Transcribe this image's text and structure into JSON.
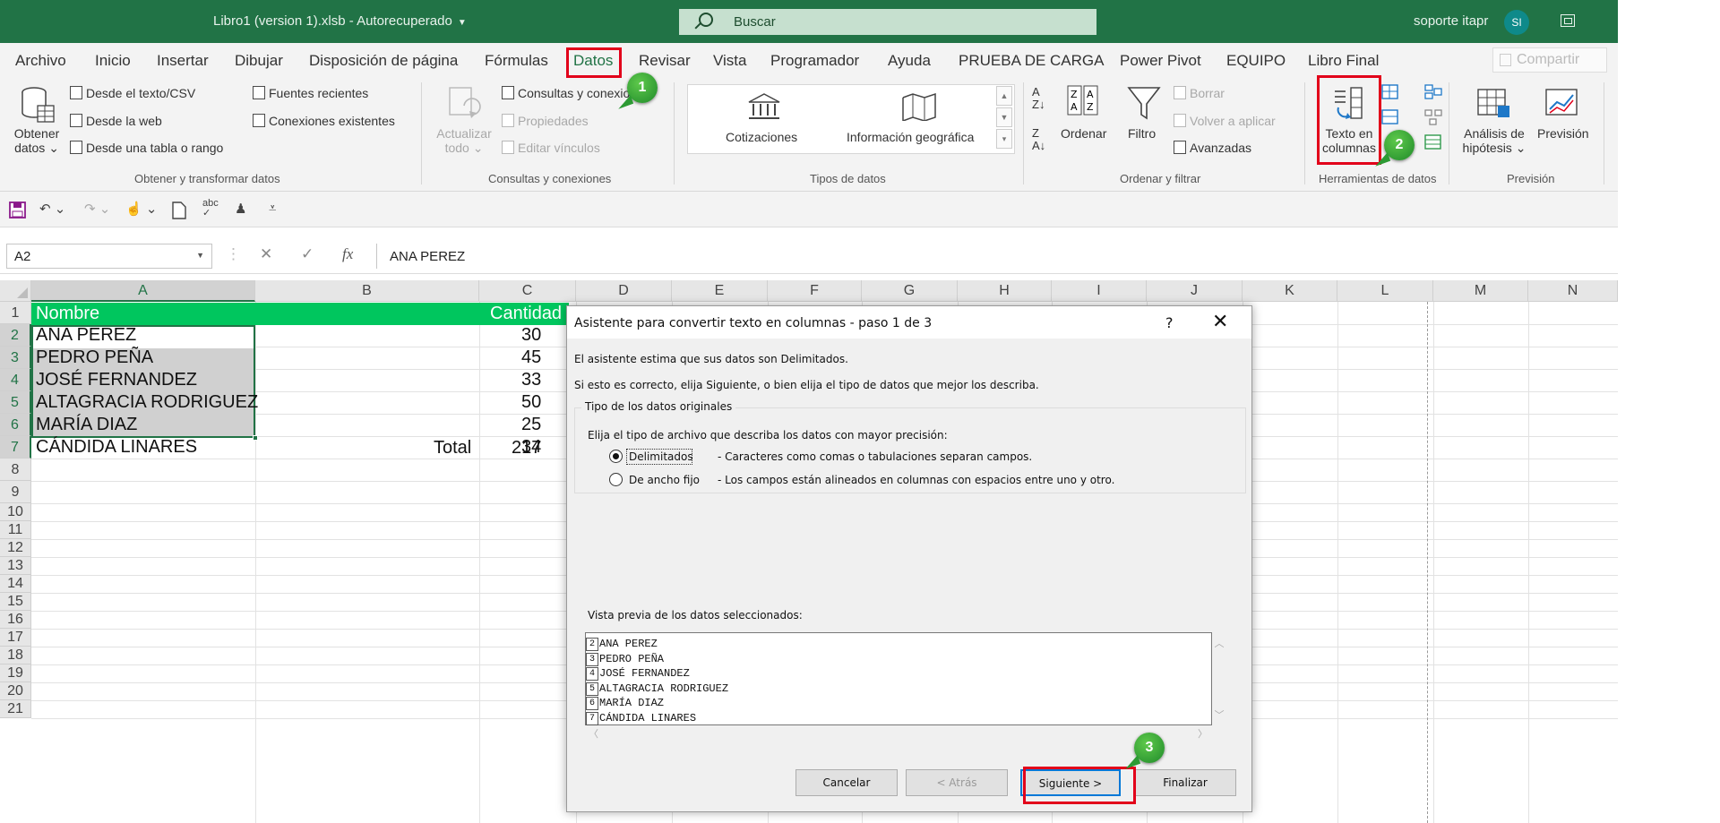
{
  "window": {
    "title": "Libro1 (version 1).xlsb  -  Autorecuperado",
    "search_placeholder": "Buscar",
    "user": "soporte itapr",
    "avatar": "SI"
  },
  "tabs": [
    "Archivo",
    "Inicio",
    "Insertar",
    "Dibujar",
    "Disposición de página",
    "Fórmulas",
    "Datos",
    "Revisar",
    "Vista",
    "Programador",
    "Ayuda",
    "PRUEBA DE CARGA",
    "Power Pivot",
    "EQUIPO",
    "Libro Final"
  ],
  "share": "Compartir",
  "ribbon": {
    "obtener": {
      "btn_line1": "Obtener",
      "btn_line2": "datos",
      "items": [
        "Desde el texto/CSV",
        "Desde la web",
        "Desde una tabla o rango",
        "Fuentes recientes",
        "Conexiones existentes"
      ],
      "label": "Obtener y transformar datos"
    },
    "consultas": {
      "refresh_line1": "Actualizar",
      "refresh_line2": "todo",
      "items": [
        "Consultas y conexiones",
        "Propiedades",
        "Editar vínculos"
      ],
      "label": "Consultas y conexiones"
    },
    "tipos": {
      "items": [
        "Cotizaciones",
        "Información geográfica"
      ],
      "label": "Tipos de datos"
    },
    "ordenar": {
      "sort": "Ordenar",
      "filter": "Filtro",
      "items": [
        "Borrar",
        "Volver a aplicar",
        "Avanzadas"
      ],
      "label": "Ordenar y filtrar"
    },
    "herramientas": {
      "btn_line1": "Texto en",
      "btn_line2": "columnas",
      "label": "Herramientas de datos"
    },
    "prevision": {
      "analysis_line1": "Análisis de",
      "analysis_line2": "hipótesis",
      "forecast": "Previsión",
      "label": "Previsión"
    }
  },
  "formula_bar": {
    "name_box": "A2",
    "fx": "fx",
    "value": "ANA PEREZ"
  },
  "grid": {
    "columns": [
      "A",
      "B",
      "C",
      "D",
      "E",
      "F",
      "G",
      "H",
      "I",
      "J",
      "K",
      "L",
      "M",
      "N"
    ],
    "rows": [
      "1",
      "2",
      "3",
      "4",
      "5",
      "6",
      "7",
      "8",
      "9",
      "10",
      "11",
      "12",
      "13",
      "14",
      "15",
      "16",
      "17",
      "18",
      "19",
      "20",
      "21"
    ],
    "header": {
      "name": "Nombre",
      "qty": "Cantidad"
    },
    "data": [
      {
        "name": "ANA PEREZ",
        "qty": "30"
      },
      {
        "name": "PEDRO PEÑA",
        "qty": "45"
      },
      {
        "name": "JOSÉ FERNANDEZ",
        "qty": "33"
      },
      {
        "name": "ALTAGRACIA RODRIGUEZ",
        "qty": "50"
      },
      {
        "name": "MARÍA DIAZ",
        "qty": "25"
      },
      {
        "name": "CÁNDIDA LINARES",
        "qty": "34"
      }
    ],
    "total_label": "Total",
    "total_value": "217"
  },
  "dialog": {
    "title": "Asistente para convertir texto en columnas - paso 1 de 3",
    "help": "?",
    "close": "✕",
    "line1": "El asistente estima que sus datos son Delimitados.",
    "line2": "Si esto es correcto, elija Siguiente, o bien elija el tipo de datos que mejor los describa.",
    "group_title": "Tipo de los datos originales",
    "instruction": "Elija el tipo de archivo que describa los datos con mayor precisión:",
    "opt1_label": "Delimitados",
    "opt1_desc": "- Caracteres como comas o tabulaciones separan campos.",
    "opt2_label": "De ancho fijo",
    "opt2_desc": "- Los campos están alineados en columnas con espacios entre uno y otro.",
    "preview_label": "Vista previa de los datos seleccionados:",
    "preview_rows": [
      {
        "n": "2",
        "t": "ANA PEREZ"
      },
      {
        "n": "3",
        "t": "PEDRO PEÑA"
      },
      {
        "n": "4",
        "t": "JOSÉ FERNANDEZ"
      },
      {
        "n": "5",
        "t": "ALTAGRACIA RODRIGUEZ"
      },
      {
        "n": "6",
        "t": "MARÍA DIAZ"
      },
      {
        "n": "7",
        "t": "CÁNDIDA LINARES"
      }
    ],
    "buttons": {
      "cancel": "Cancelar",
      "back": "< Atrás",
      "next": "Siguiente >",
      "finish": "Finalizar"
    }
  },
  "annotations": {
    "step1": "1",
    "step2": "2",
    "step3": "3"
  },
  "colors": {
    "excel_green": "#217346",
    "header_fill": "#00c65e",
    "highlight_red": "#e2001a",
    "badge_green": "#2c9a33"
  }
}
